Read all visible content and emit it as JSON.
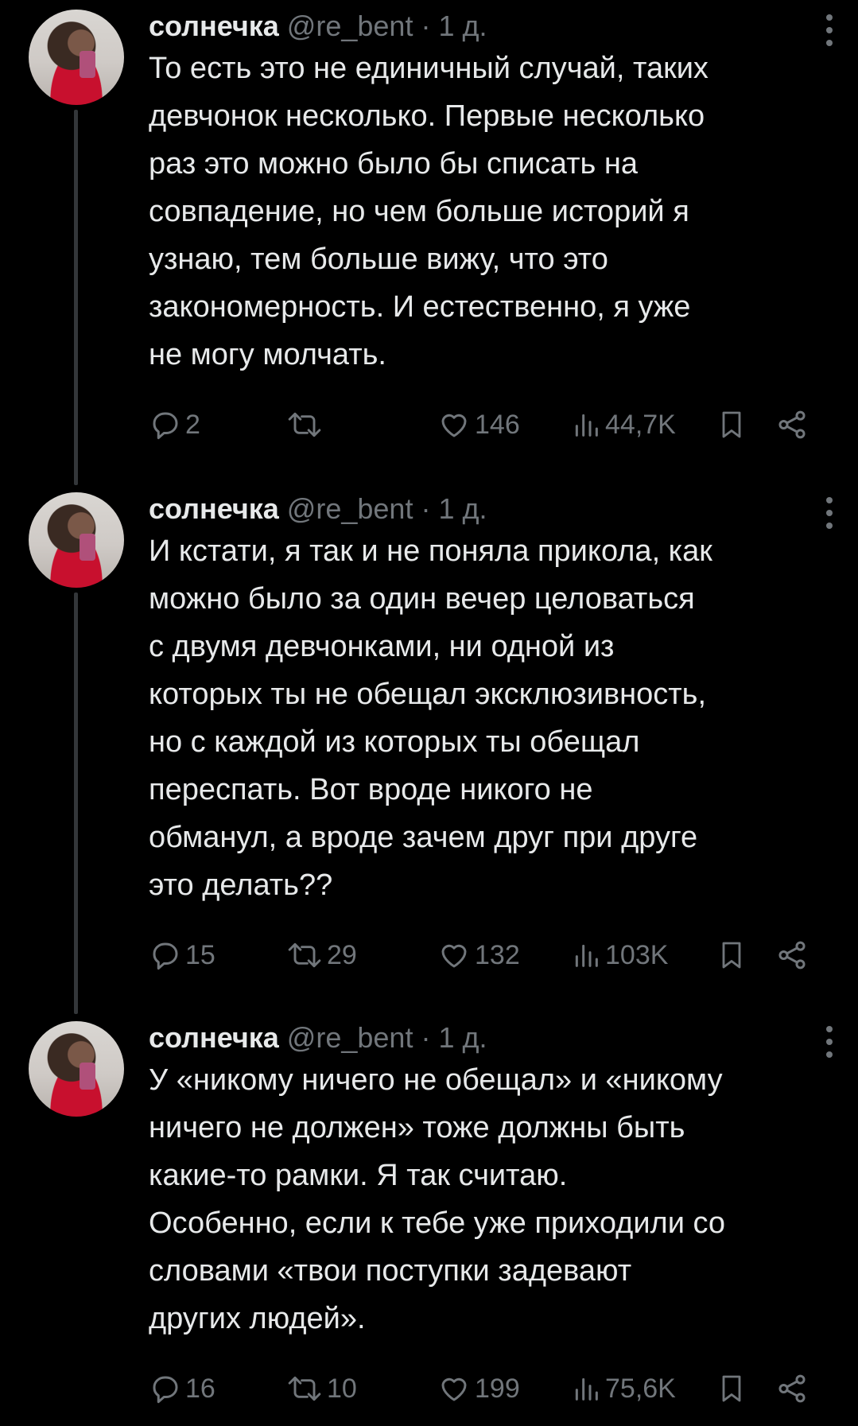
{
  "tweets": [
    {
      "name": "солнечка",
      "handle": "@re_bent",
      "time": "1 д.",
      "text": "То есть это не единичный случай, таких\nдевчонок несколько. Первые несколько\nраз это можно было бы списать на\nсовпадение, но чем больше историй я\nузнаю, тем больше вижу, что это\nзакономерность. И естественно, я уже\nне могу молчать.",
      "replies": "2",
      "retweets": "",
      "likes": "146",
      "views": "44,7K"
    },
    {
      "name": "солнечка",
      "handle": "@re_bent",
      "time": "1 д.",
      "text": "И кстати, я так и не поняла прикола, как\nможно было за один вечер целоваться\nс двумя девчонками, ни одной из\nкоторых ты не обещал эксклюзивность,\nно с каждой из которых ты обещал\nпереспать. Вот вроде никого не\nобманул, а вроде зачем друг при друге\nэто делать??",
      "replies": "15",
      "retweets": "29",
      "likes": "132",
      "views": "103K"
    },
    {
      "name": "солнечка",
      "handle": "@re_bent",
      "time": "1 д.",
      "text": "У «никому ничего не обещал» и «никому\nничего не должен» тоже должны быть\nкакие-то рамки. Я так считаю.\nОсобенно, если к тебе уже приходили со\nсловами «твои поступки задевают\nдругих людей».",
      "replies": "16",
      "retweets": "10",
      "likes": "199",
      "views": "75,6K"
    }
  ],
  "icons": {
    "reply": "reply-icon",
    "retweet": "retweet-icon",
    "like": "heart-icon",
    "views": "views-icon",
    "bookmark": "bookmark-icon",
    "share": "share-icon",
    "more": "more-vertical-icon"
  },
  "colors": {
    "background": "#000000",
    "text": "#e7e9ea",
    "secondary": "#71767b",
    "thread_line": "#333639"
  }
}
